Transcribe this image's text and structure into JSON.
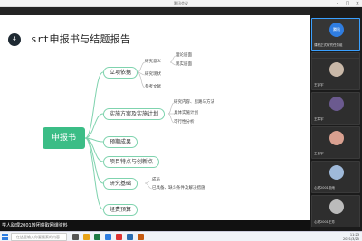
{
  "window": {
    "title": "腾讯会议"
  },
  "slide": {
    "number": "4",
    "title": "srt申报书与结题报告",
    "root": "申报书",
    "branches": [
      {
        "label": "立项依据",
        "leaves": [
          "研究意义",
          "研究现状",
          "参考文献"
        ],
        "sub": [
          "理论层面",
          "现实层面"
        ]
      },
      {
        "label": "实施方案及实施计划",
        "leaves": [
          "研究内容、思路与方法",
          "具体实施计划",
          "可行性分析"
        ]
      },
      {
        "label": "预期成果",
        "leaves": []
      },
      {
        "label": "项目特点与创新点",
        "leaves": []
      },
      {
        "label": "研究基础",
        "leaves": [
          "成员",
          "已具备、缺少条件及解决措施"
        ]
      },
      {
        "label": "经费预算",
        "leaves": []
      }
    ]
  },
  "caption": "学人助理2001转团获取网课资料",
  "participants": [
    {
      "name": "课程正式研究任务组",
      "avatar_color": "#2f7de1",
      "avatar_text": "腾讯"
    },
    {
      "name": "正在讲话 · 课程2001系统提醒",
      "avatar_color": "#3a3a3a",
      "avatar_text": ""
    },
    {
      "name": "王钟宇",
      "avatar_color": "#c9b8a8",
      "avatar_text": ""
    },
    {
      "name": "王寒宇",
      "avatar_color": "#6b5a8f",
      "avatar_text": ""
    },
    {
      "name": "王依宇",
      "avatar_color": "#d9a090",
      "avatar_text": ""
    },
    {
      "name": "心理2001张雨",
      "avatar_color": "#9fb9d9",
      "avatar_text": ""
    },
    {
      "name": "心理2001王芳",
      "avatar_color": "#bbbbbb",
      "avatar_text": ""
    }
  ],
  "taskbar": {
    "search_placeholder": "在这里输入你要搜索的内容",
    "time": "11:23",
    "date": "2021/3/25"
  }
}
